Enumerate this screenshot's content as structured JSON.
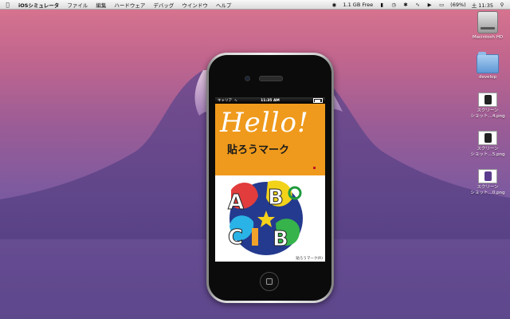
{
  "menubar": {
    "apple": "",
    "app": "iOSシミュレータ",
    "items": [
      "ファイル",
      "編集",
      "ハードウェア",
      "デバッグ",
      "ウインドウ",
      "ヘルプ"
    ],
    "right": {
      "disk_free": "1.1 GB Free",
      "battery": "(69%)",
      "clock": "土 11:35"
    }
  },
  "desktop_icons": [
    {
      "label": "Macintosh HD",
      "icon": "hard-drive-icon"
    },
    {
      "label": "develop",
      "icon": "folder-icon"
    },
    {
      "label": "スクリーン\nショット…4.png",
      "icon": "screenshot-icon"
    },
    {
      "label": "スクリーン\nショット…5.png",
      "icon": "screenshot-icon"
    },
    {
      "label": "スクリーン\nショット…0.png",
      "icon": "screenshot-icon"
    }
  ],
  "simulator": {
    "status_carrier": "キャリア",
    "status_time": "11:35 AM",
    "app_banner_title": "Hello!",
    "app_banner_sub": "貼ろうマーク",
    "app_footer": "貼ろうマーク(R)",
    "banner_color": "#ef9a1c"
  }
}
